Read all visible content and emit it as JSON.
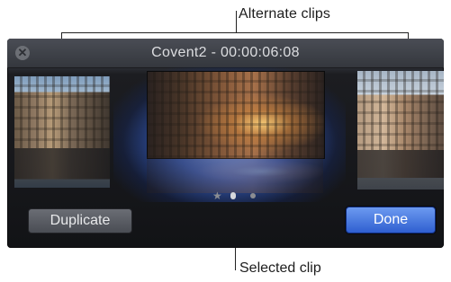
{
  "callouts": {
    "top": "Alternate clips",
    "bottom": "Selected clip"
  },
  "window": {
    "title": "Covent2 - 00:00:06:08"
  },
  "buttons": {
    "duplicate": "Duplicate",
    "done": "Done"
  },
  "pager": {
    "star": "★"
  },
  "colors": {
    "selection_glow": "#4f86f7",
    "done_button": "#2f5fd0"
  }
}
